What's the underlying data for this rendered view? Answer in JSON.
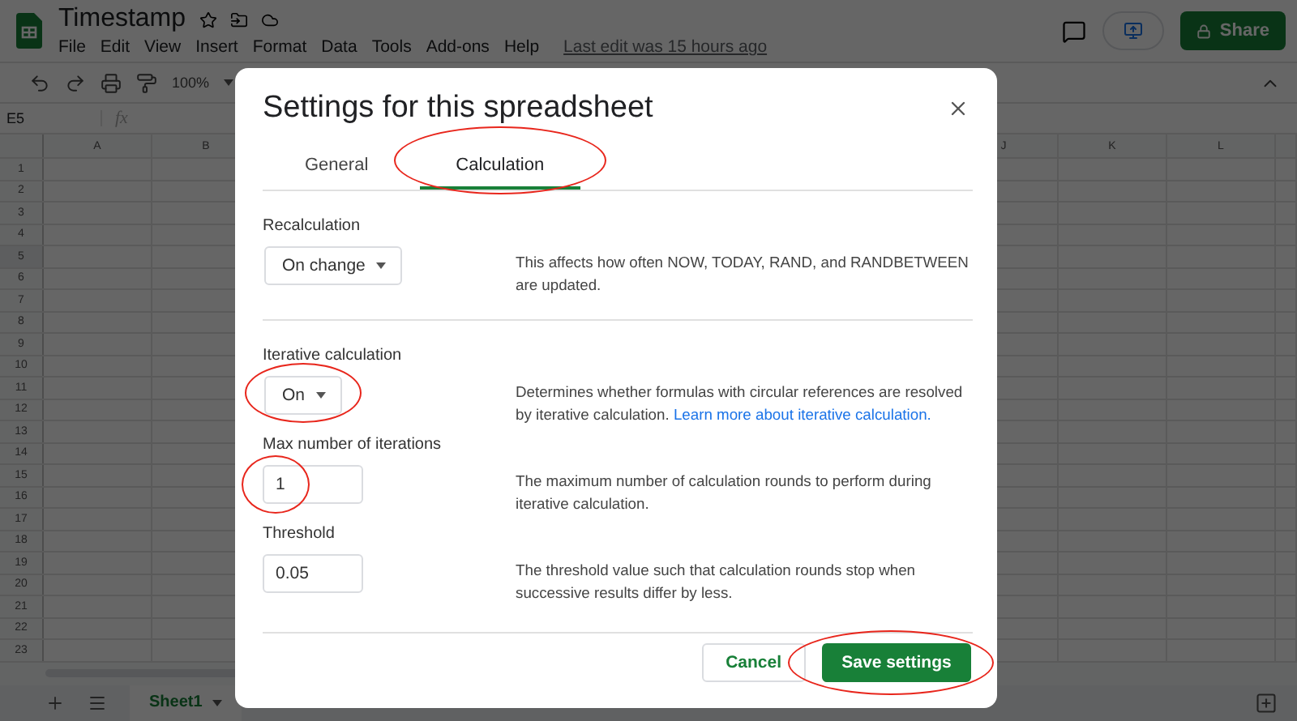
{
  "app": {
    "title": "Timestamp",
    "menu": [
      "File",
      "Edit",
      "View",
      "Insert",
      "Format",
      "Data",
      "Tools",
      "Add-ons",
      "Help"
    ],
    "last_edit": "Last edit was 15 hours ago",
    "share_button": "Share",
    "zoom": "100%",
    "name_box": "E5",
    "formula_label": "fx",
    "columns": [
      "A",
      "B",
      "J",
      "K",
      "L"
    ],
    "rows": [
      "1",
      "2",
      "3",
      "4",
      "5",
      "6",
      "7",
      "8",
      "9",
      "10",
      "11",
      "12",
      "13",
      "14",
      "15",
      "16",
      "17",
      "18",
      "19",
      "20",
      "21",
      "22",
      "23"
    ],
    "sheet_tabs": [
      {
        "label": "Sheet1",
        "selected": true
      }
    ]
  },
  "dialog": {
    "title": "Settings for this spreadsheet",
    "tabs": [
      {
        "label": "General",
        "selected": false,
        "highlighted": false
      },
      {
        "label": "Calculation",
        "selected": true,
        "highlighted": true
      }
    ],
    "sections": [
      {
        "settings": [
          {
            "kind": "dropdown",
            "label": "Recalculation",
            "value": "On change",
            "highlighted": false,
            "description": "This affects how often NOW, TODAY, RAND, and RANDBETWEEN are updated."
          }
        ]
      },
      {
        "settings": [
          {
            "kind": "dropdown",
            "label": "Iterative calculation",
            "value": "On",
            "highlighted": true,
            "description": "Determines whether formulas with circular references are resolved by iterative calculation.",
            "link": "Learn more about iterative calculation."
          },
          {
            "kind": "input",
            "label": "Max number of iterations",
            "value": "1",
            "highlighted": true,
            "description": "The maximum number of calculation rounds to perform during iterative calculation."
          },
          {
            "kind": "input",
            "label": "Threshold",
            "value": "0.05",
            "highlighted": false,
            "description": "The threshold value such that calculation rounds stop when successive results differ by less."
          }
        ]
      }
    ],
    "cancel_button": {
      "label": "Cancel",
      "highlighted": false
    },
    "save_button": {
      "label": "Save settings",
      "highlighted": true
    }
  }
}
